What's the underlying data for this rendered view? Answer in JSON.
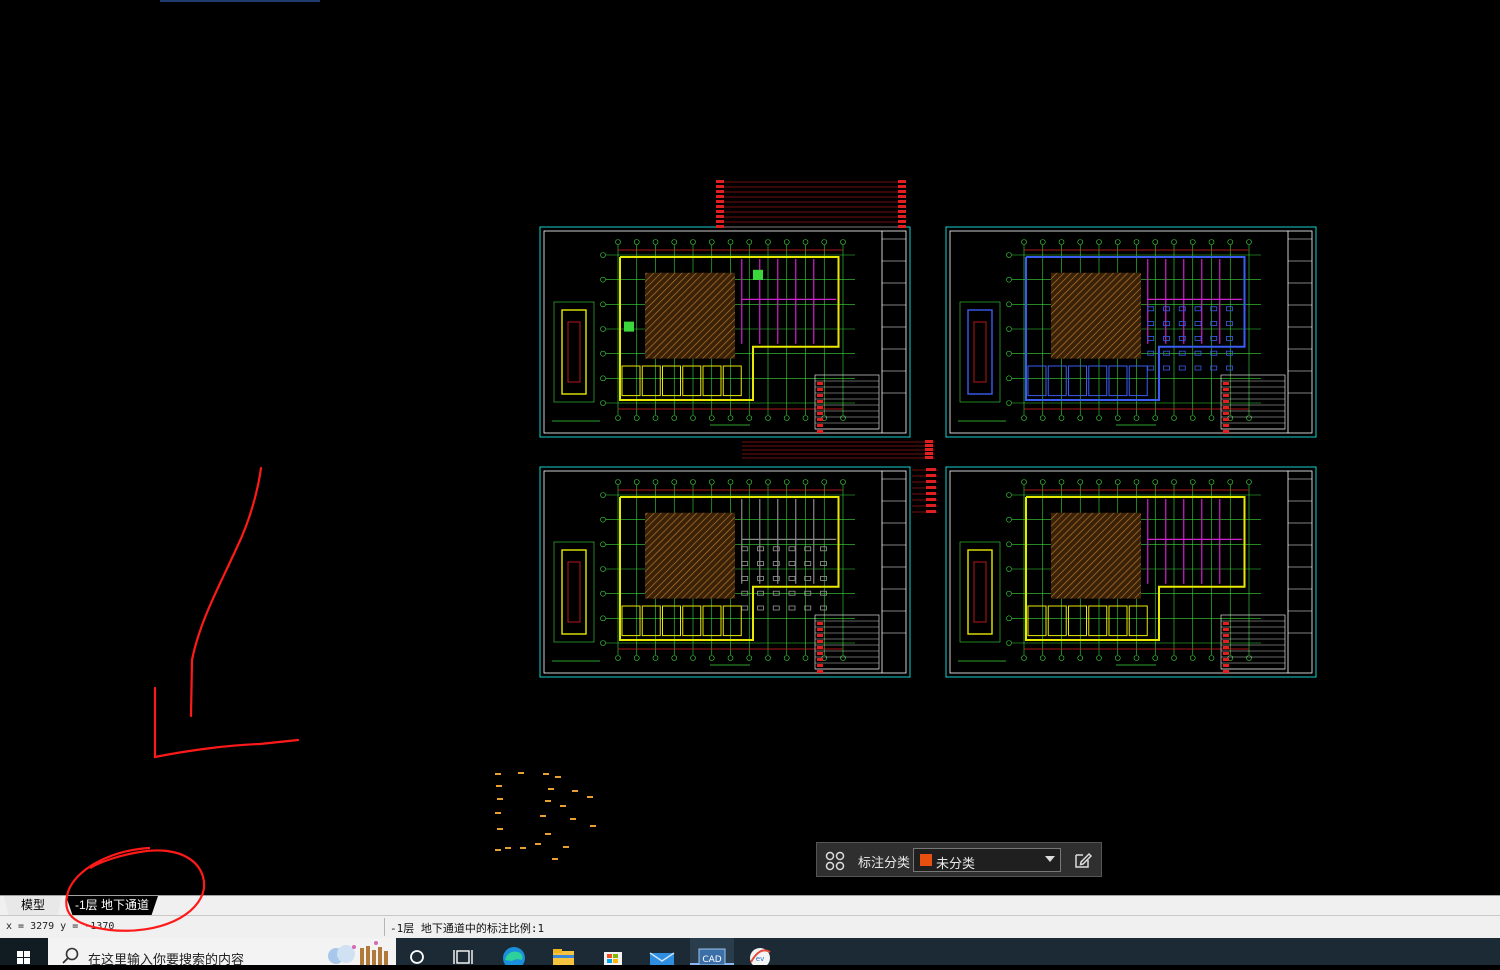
{
  "drawing_canvas": {
    "background": "#000000",
    "colors": {
      "frame": "#18d0d0",
      "grid": "#3ad83a",
      "wall": "#e8e800",
      "partition": "#d020d0",
      "hatch": "#b8742a",
      "dim": "#e02020",
      "text": "#ffffff",
      "room_fill": "#3ad83a",
      "blue_detail": "#3a5cf0"
    },
    "sheets": [
      {
        "name": "sheet-top-left",
        "variant": "yellow"
      },
      {
        "name": "sheet-top-right",
        "variant": "blue"
      },
      {
        "name": "sheet-bottom-left",
        "variant": "gray"
      },
      {
        "name": "sheet-bottom-right",
        "variant": "magenta"
      }
    ],
    "markup_color": "#ff1a1a"
  },
  "layout_tabs": {
    "model_label": "模型",
    "layout_label": "-1层 地下通道"
  },
  "status_bar": {
    "coordinates": "x = 3279  y = -1370",
    "annotation_scale": "-1层 地下通道中的标注比例:1"
  },
  "annotation_toolbar": {
    "label": "标注分类",
    "selected_value": "未分类",
    "swatch_color": "#e8500f",
    "grid_icon": "category-grid-icon",
    "edit_icon": "edit-icon"
  },
  "taskbar": {
    "search_placeholder": "在这里输入你要搜索的内容",
    "icons": [
      "windows-start-icon",
      "search-icon",
      "cortana-icon",
      "task-view-icon",
      "edge-icon",
      "file-explorer-icon",
      "store-icon",
      "mail-icon",
      "cad-app-icon",
      "ev-recorder-icon"
    ],
    "cad_label": "CAD"
  }
}
